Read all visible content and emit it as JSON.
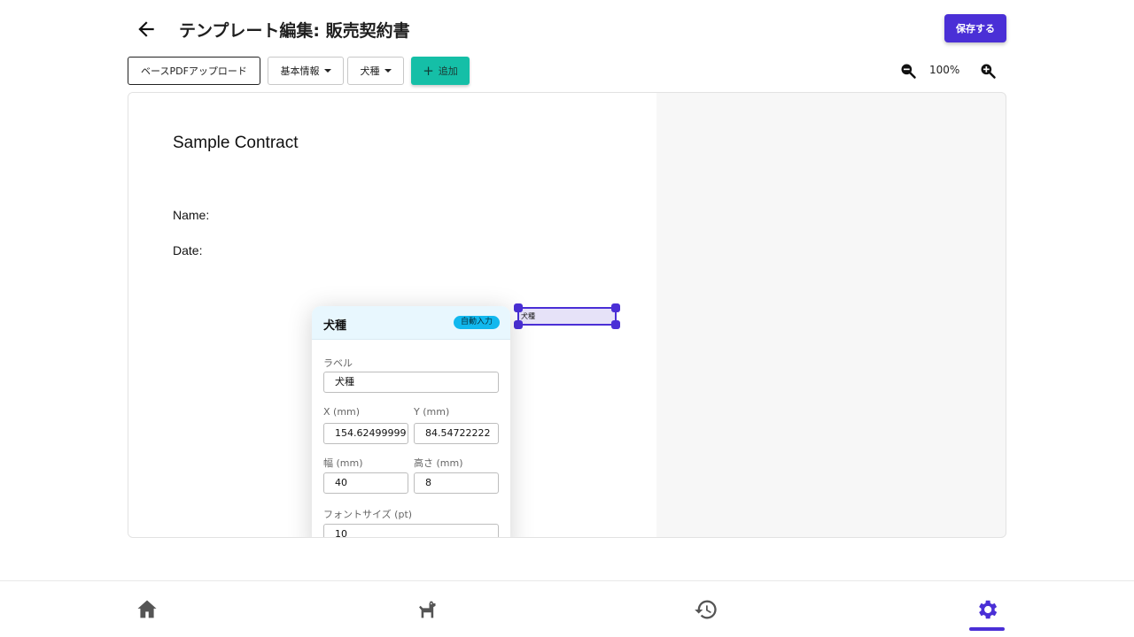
{
  "header": {
    "title": "テンプレート編集: 販売契約書",
    "save_label": "保存する"
  },
  "toolbar": {
    "upload_label": "ベースPDFアップロード",
    "basic_info_label": "基本情報",
    "dog_breed_label": "犬種",
    "add_label": "追加",
    "zoom_level": "100%"
  },
  "document": {
    "title": "Sample Contract",
    "name_label": "Name:",
    "date_label": "Date:",
    "field_label": "犬種"
  },
  "panel": {
    "title": "犬種",
    "badge": "自動入力",
    "label_caption": "ラベル",
    "label_value": "犬種",
    "x_caption": "X (mm)",
    "x_value": "154.62499999",
    "y_caption": "Y (mm)",
    "y_value": "84.54722222",
    "width_caption": "幅 (mm)",
    "width_value": "40",
    "height_caption": "高さ (mm)",
    "height_value": "8",
    "font_caption": "フォントサイズ (pt)",
    "font_value": "10"
  },
  "nav": {
    "items": [
      {
        "icon": "home-icon"
      },
      {
        "icon": "dog-icon"
      },
      {
        "icon": "history-icon"
      },
      {
        "icon": "settings-gear-icon",
        "active": true
      }
    ]
  },
  "colors": {
    "primary": "#4a2fd6",
    "accent_green": "#15bfa7",
    "badge_blue": "#12b8ee",
    "icon_gray": "#555555"
  }
}
